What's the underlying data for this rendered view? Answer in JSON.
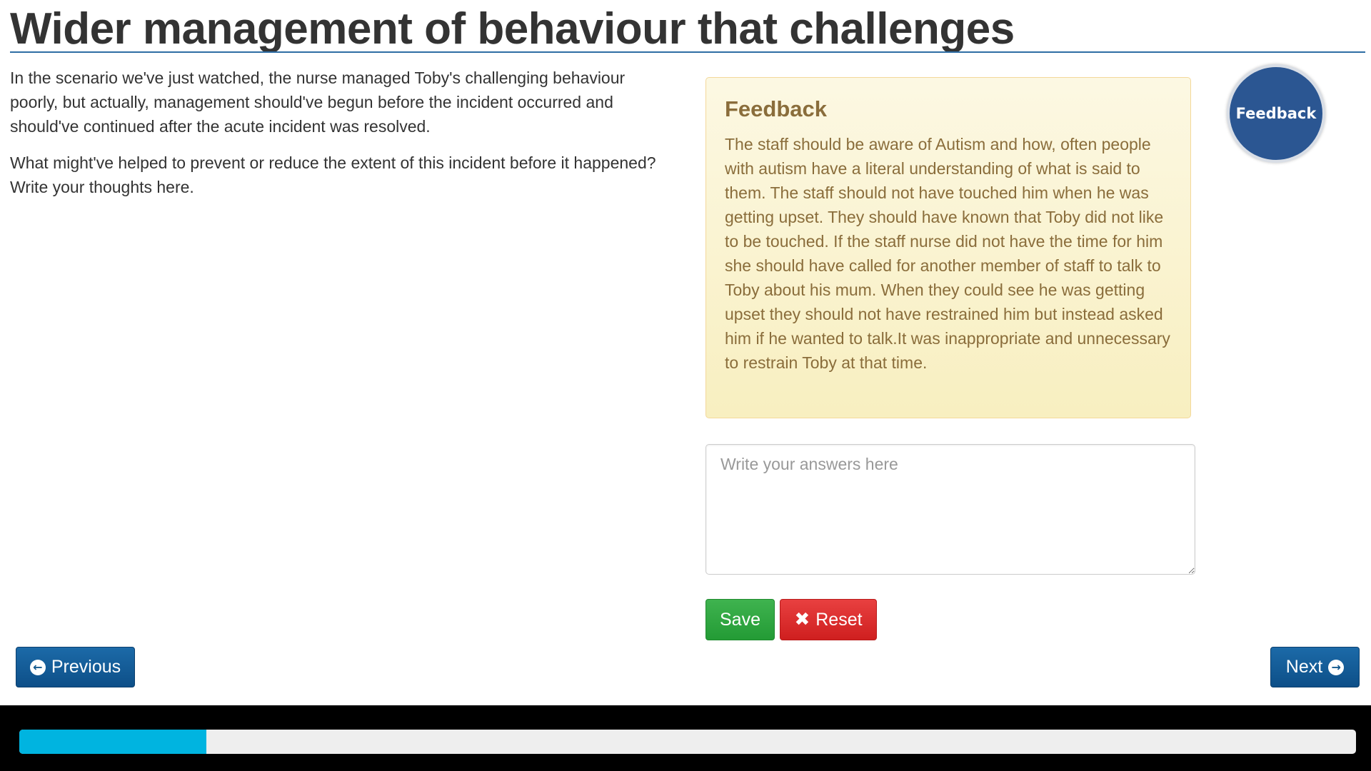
{
  "header": {
    "title": "Wider management of behaviour that challenges"
  },
  "intro": {
    "paragraph1": "In the scenario we've just watched, the nurse managed Toby's challenging behaviour poorly, but actually, management should've begun before the incident occurred and should've continued after the acute incident was resolved.",
    "paragraph2": "What might've helped to prevent or reduce the extent of this incident before it happened? Write your thoughts here."
  },
  "feedback": {
    "heading": "Feedback",
    "text": "The staff should be aware of Autism and how, often people with autism have a literal understanding of what is said to them. The staff should not have touched him when he was getting upset. They should have known that Toby did not like to be touched. If the staff nurse did not have the time for him she should have called for another member of staff to talk to Toby about his mum. When they could see he was getting upset they should not have restrained him but instead asked him if he wanted to talk.It was inappropriate and unnecessary to restrain Toby at that time.",
    "button_label": "Feedback",
    "button_color": "#2b5692"
  },
  "answer": {
    "placeholder": "Write your answers here",
    "value": ""
  },
  "actions": {
    "save_label": "Save",
    "reset_label": "Reset",
    "reset_icon": "times-icon",
    "save_color": "#239b35",
    "reset_color": "#cf1f1f"
  },
  "navigation": {
    "previous_label": "Previous",
    "previous_icon": "arrow-circle-left-icon",
    "next_label": "Next",
    "next_icon": "arrow-circle-right-icon",
    "nav_color": "#0d4f88"
  },
  "progress": {
    "fraction": 0.14,
    "fill_color": "#00b4e0"
  }
}
